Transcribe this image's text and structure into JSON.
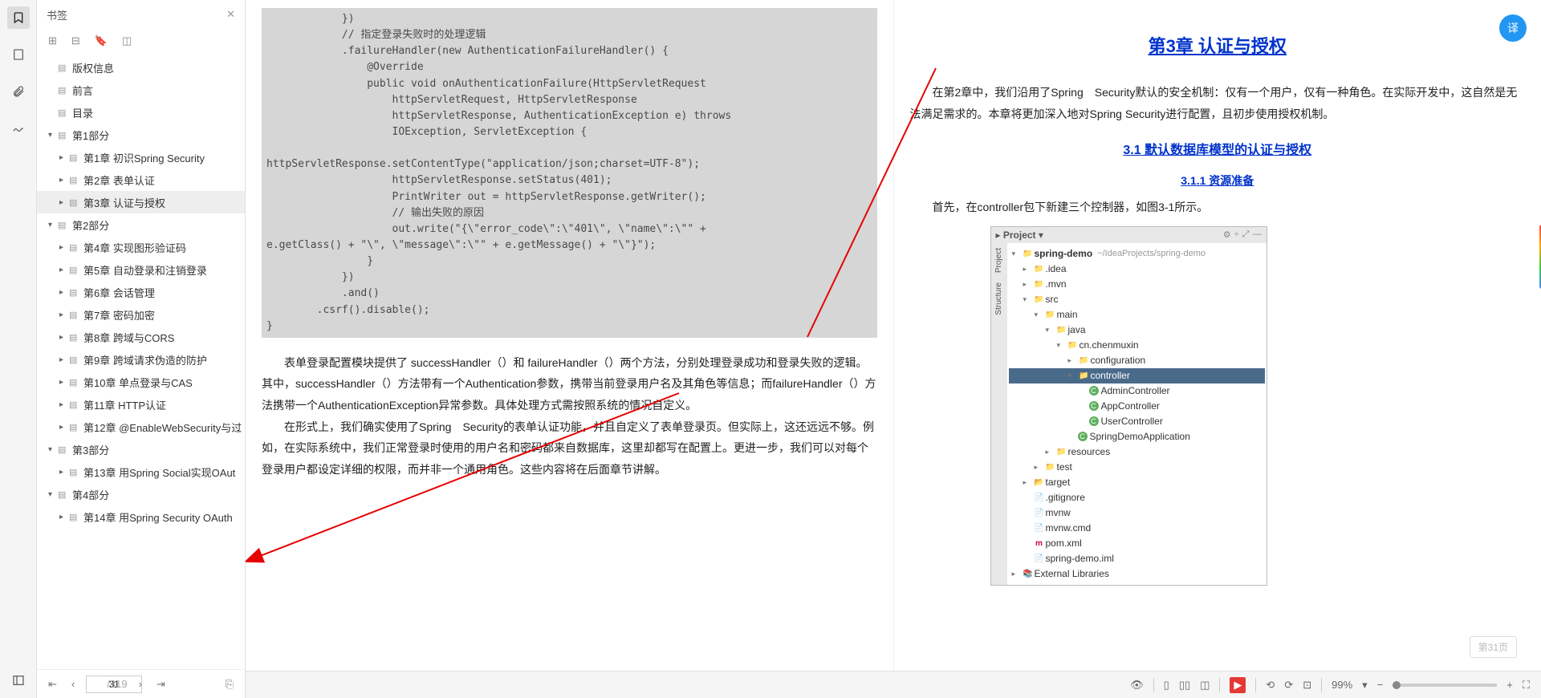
{
  "sidebar": {
    "title": "书签",
    "toolbar_icons": [
      "expand-icon",
      "collapse-icon",
      "add-bookmark-icon",
      "bookmark-icon"
    ],
    "items": [
      {
        "label": "版权信息",
        "level": 0,
        "caret": ""
      },
      {
        "label": "前言",
        "level": 0,
        "caret": ""
      },
      {
        "label": "目录",
        "level": 0,
        "caret": ""
      },
      {
        "label": "第1部分",
        "level": 0,
        "caret": "▾"
      },
      {
        "label": "第1章 初识Spring Security",
        "level": 1,
        "caret": "▸"
      },
      {
        "label": "第2章 表单认证",
        "level": 1,
        "caret": "▸"
      },
      {
        "label": "第3章 认证与授权",
        "level": 1,
        "caret": "▸",
        "selected": true
      },
      {
        "label": "第2部分",
        "level": 0,
        "caret": "▾"
      },
      {
        "label": "第4章 实现图形验证码",
        "level": 1,
        "caret": "▸"
      },
      {
        "label": "第5章 自动登录和注销登录",
        "level": 1,
        "caret": "▸"
      },
      {
        "label": "第6章 会话管理",
        "level": 1,
        "caret": "▸"
      },
      {
        "label": "第7章 密码加密",
        "level": 1,
        "caret": "▸"
      },
      {
        "label": "第8章 跨域与CORS",
        "level": 1,
        "caret": "▸"
      },
      {
        "label": "第9章 跨域请求伪造的防护",
        "level": 1,
        "caret": "▸"
      },
      {
        "label": "第10章 单点登录与CAS",
        "level": 1,
        "caret": "▸"
      },
      {
        "label": "第11章 HTTP认证",
        "level": 1,
        "caret": "▸"
      },
      {
        "label": "第12章 @EnableWebSecurity与过",
        "level": 1,
        "caret": "▸"
      },
      {
        "label": "第3部分",
        "level": 0,
        "caret": "▾"
      },
      {
        "label": "第13章 用Spring Social实现OAut",
        "level": 1,
        "caret": "▸"
      },
      {
        "label": "第4部分",
        "level": 0,
        "caret": "▾"
      },
      {
        "label": "第14章 用Spring Security OAuth",
        "level": 1,
        "caret": "▸"
      }
    ],
    "page_current": "31",
    "page_total": "/319"
  },
  "left_page": {
    "code": "            })\n            // 指定登录失败时的处理逻辑\n            .failureHandler(new AuthenticationFailureHandler() {\n                @Override\n                public void onAuthenticationFailure(HttpServletRequest\n                    httpServletRequest, HttpServletResponse\n                    httpServletResponse, AuthenticationException e) throws\n                    IOException, ServletException {\n\nhttpServletResponse.setContentType(\"application/json;charset=UTF-8\");\n                    httpServletResponse.setStatus(401);\n                    PrintWriter out = httpServletResponse.getWriter();\n                    // 输出失败的原因\n                    out.write(\"{\\\"error_code\\\":\\\"401\\\", \\\"name\\\":\\\"\" +\ne.getClass() + \"\\\", \\\"message\\\":\\\"\" + e.getMessage() + \"\\\"}\");\n                }\n            })\n            .and()\n        .csrf().disable();\n}",
    "para1": "表单登录配置模块提供了 successHandler（）和 failureHandler（）两个方法，分别处理登录成功和登录失败的逻辑。其中，successHandler（）方法带有一个Authentication参数，携带当前登录用户名及其角色等信息；而failureHandler（）方法携带一个AuthenticationException异常参数。具体处理方式需按照系统的情况自定义。",
    "para2": "在形式上，我们确实使用了Spring　Security的表单认证功能，并且自定义了表单登录页。但实际上，这还远远不够。例如，在实际系统中，我们正常登录时使用的用户名和密码都来自数据库，这里却都写在配置上。更进一步，我们可以对每个登录用户都设定详细的权限，而并非一个通用角色。这些内容将在后面章节讲解。"
  },
  "right_page": {
    "chapter_title": "第3章 认证与授权",
    "intro": "在第2章中，我们沿用了Spring　Security默认的安全机制：仅有一个用户，仅有一种角色。在实际开发中，这自然是无法满足需求的。本章将更加深入地对Spring Security进行配置，且初步使用授权机制。",
    "section_title": "3.1 默认数据库模型的认证与授权",
    "subsection_title": "3.1.1 资源准备",
    "resource_text": "首先，在controller包下新建三个控制器，如图3-1所示。",
    "page_badge": "第31页",
    "ide": {
      "header": "Project",
      "sidetabs": [
        "Project",
        "Structure"
      ],
      "items": [
        {
          "indent": 0,
          "caret": "▾",
          "icon": "📁",
          "label": "spring-demo",
          "suffix": "~/IdeaProjects/spring-demo",
          "bold": true,
          "cls": "folder-blue"
        },
        {
          "indent": 1,
          "caret": "▸",
          "icon": "📁",
          "label": ".idea",
          "cls": "folder"
        },
        {
          "indent": 1,
          "caret": "▸",
          "icon": "📁",
          "label": ".mvn",
          "cls": "folder"
        },
        {
          "indent": 1,
          "caret": "▾",
          "icon": "📁",
          "label": "src",
          "cls": "folder-blue"
        },
        {
          "indent": 2,
          "caret": "▾",
          "icon": "📁",
          "label": "main",
          "cls": "folder-blue"
        },
        {
          "indent": 3,
          "caret": "▾",
          "icon": "📁",
          "label": "java",
          "cls": "folder-blue"
        },
        {
          "indent": 4,
          "caret": "▾",
          "icon": "📁",
          "label": "cn.chenmuxin",
          "cls": "folder"
        },
        {
          "indent": 5,
          "caret": "▸",
          "icon": "📁",
          "label": "configuration",
          "cls": "folder"
        },
        {
          "indent": 5,
          "caret": "▾",
          "icon": "📁",
          "label": "controller",
          "selected": true,
          "cls": "folder"
        },
        {
          "indent": 6,
          "caret": "",
          "icon": "C",
          "label": "AdminController",
          "ctype": "class"
        },
        {
          "indent": 6,
          "caret": "",
          "icon": "C",
          "label": "AppController",
          "ctype": "class"
        },
        {
          "indent": 6,
          "caret": "",
          "icon": "C",
          "label": "UserController",
          "ctype": "class"
        },
        {
          "indent": 5,
          "caret": "",
          "icon": "C",
          "label": "SpringDemoApplication",
          "ctype": "class"
        },
        {
          "indent": 3,
          "caret": "▸",
          "icon": "📁",
          "label": "resources",
          "cls": "folder"
        },
        {
          "indent": 2,
          "caret": "▸",
          "icon": "📁",
          "label": "test",
          "cls": "folder-blue"
        },
        {
          "indent": 1,
          "caret": "▸",
          "icon": "📁",
          "label": "target",
          "cls": "folder",
          "orange": true
        },
        {
          "indent": 1,
          "caret": "",
          "icon": "📄",
          "label": ".gitignore"
        },
        {
          "indent": 1,
          "caret": "",
          "icon": "📄",
          "label": "mvnw"
        },
        {
          "indent": 1,
          "caret": "",
          "icon": "📄",
          "label": "mvnw.cmd"
        },
        {
          "indent": 1,
          "caret": "",
          "icon": "m",
          "label": "pom.xml",
          "maven": true
        },
        {
          "indent": 1,
          "caret": "",
          "icon": "📄",
          "label": "spring-demo.iml"
        },
        {
          "indent": 0,
          "caret": "▸",
          "icon": "📚",
          "label": "External Libraries"
        }
      ]
    }
  },
  "bottom": {
    "zoom": "99%"
  }
}
